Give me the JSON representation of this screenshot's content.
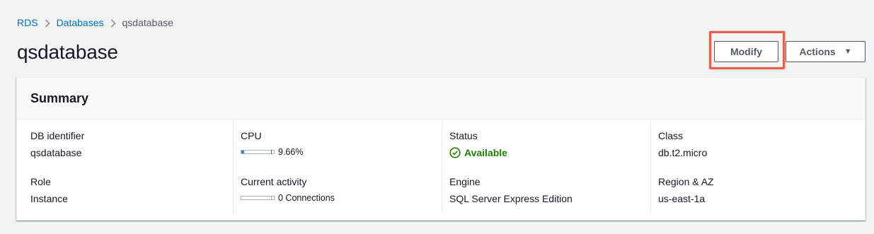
{
  "breadcrumb": {
    "items": [
      {
        "label": "RDS"
      },
      {
        "label": "Databases"
      },
      {
        "label": "qsdatabase"
      }
    ]
  },
  "page": {
    "title": "qsdatabase"
  },
  "toolbar": {
    "modify_label": "Modify",
    "actions_label": "Actions"
  },
  "summary": {
    "title": "Summary",
    "db_identifier": {
      "label": "DB identifier",
      "value": "qsdatabase"
    },
    "role": {
      "label": "Role",
      "value": "Instance"
    },
    "cpu": {
      "label": "CPU",
      "value": "9.66%",
      "fraction": 0.0966
    },
    "current_activity": {
      "label": "Current activity",
      "value": "0 Connections",
      "fraction": 0
    },
    "status": {
      "label": "Status",
      "value": "Available",
      "icon": "check-circle-icon",
      "color": "#1d8102"
    },
    "engine": {
      "label": "Engine",
      "value": "SQL Server Express Edition"
    },
    "class": {
      "label": "Class",
      "value": "db.t2.micro"
    },
    "region_az": {
      "label": "Region & AZ",
      "value": "us-east-1a"
    }
  },
  "colors": {
    "link": "#0073bb",
    "highlight": "#e8604c",
    "success": "#1d8102"
  }
}
